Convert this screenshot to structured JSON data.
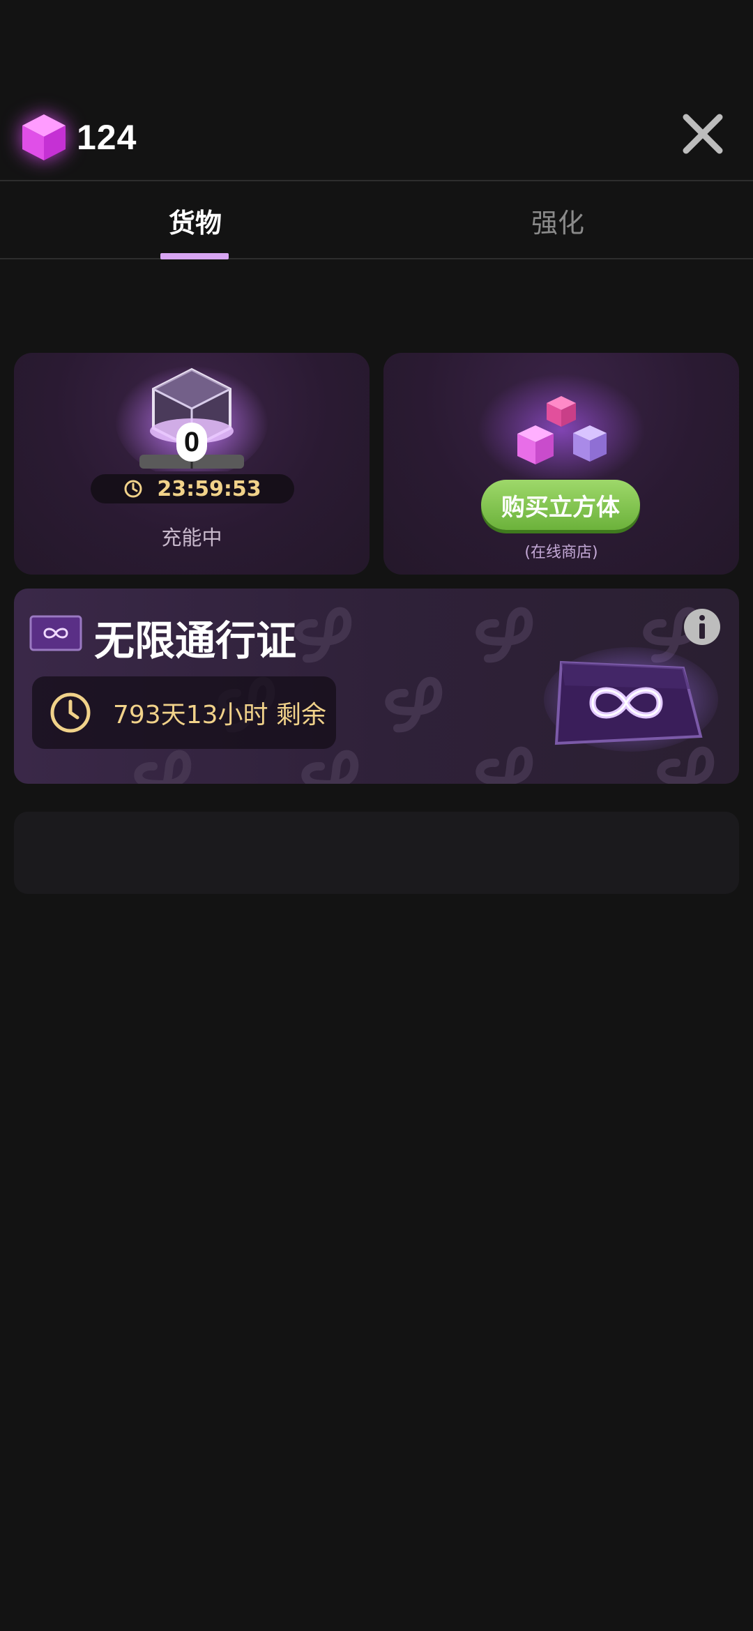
{
  "header": {
    "currency_value": "124",
    "currency_icon": "cube-gem-icon",
    "close_icon": "close-icon"
  },
  "tabs": [
    {
      "label": "货物",
      "active": true
    },
    {
      "label": "强化",
      "active": false
    }
  ],
  "charge_card": {
    "cube_count": "0",
    "timer": "23:59:53",
    "status_label": "充能中"
  },
  "buy_card": {
    "button_label": "购买立方体",
    "sub_label": "(在线商店)"
  },
  "pass_card": {
    "title": "无限通行证",
    "remaining": "793天13小时 剩余",
    "info_icon": "info-icon"
  },
  "colors": {
    "background": "#131313",
    "accent_tab": "#d7a5f2",
    "timer_text": "#f1d28a",
    "buy_button": "#8cc955"
  }
}
